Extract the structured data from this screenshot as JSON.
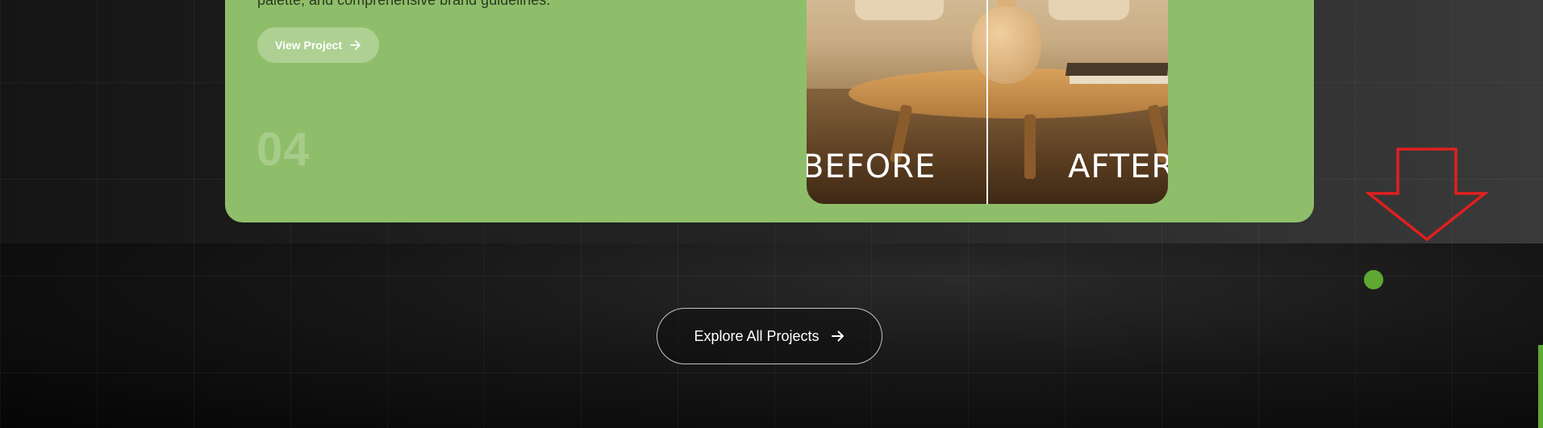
{
  "project_card": {
    "description": "palette, and comprehensive brand guidelines.",
    "view_button_label": "View Project",
    "number": "04",
    "compare": {
      "before_label": "BEFORE",
      "after_label": "AFTER"
    }
  },
  "explore_button_label": "Explore All Projects",
  "icons": {
    "view_arrow": "arrow-right-icon",
    "explore_arrow": "arrow-right-icon",
    "overlay_arrow": "arrow-down-icon"
  },
  "colors": {
    "card_bg": "#8fbe6a",
    "accent_green": "#5fa832",
    "annotation_red": "#e0201f"
  }
}
